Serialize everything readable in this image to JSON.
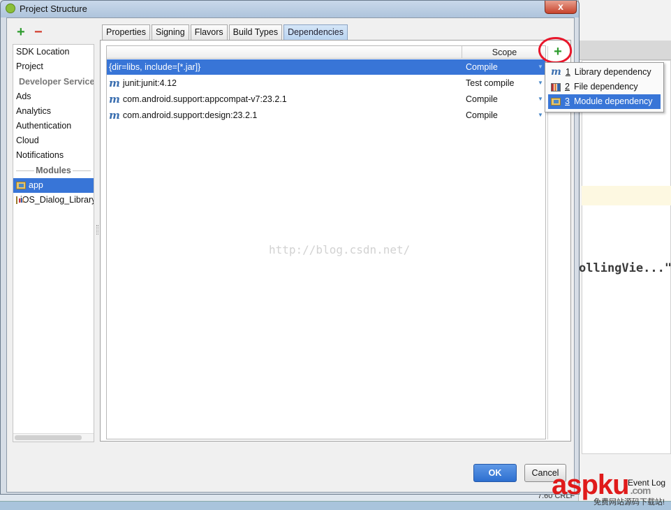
{
  "window": {
    "title": "Project Structure",
    "close_label": "x"
  },
  "background": {
    "code_text": "ollingVie...\"",
    "event_log": "Event Log",
    "status": "7:60  CRLF"
  },
  "watermark": {
    "main": "aspku",
    "suffix": ".com",
    "sub": "免费网站源码下载站!"
  },
  "left_panel": {
    "add_label": "+",
    "remove_label": "−",
    "items": [
      "SDK Location",
      "Project"
    ],
    "developer_services_header": "Developer Services",
    "developer_services": [
      "Ads",
      "Analytics",
      "Authentication",
      "Cloud",
      "Notifications"
    ],
    "modules_header": "Modules",
    "modules": [
      {
        "label": "app",
        "selected": true,
        "icon": "module-folder-icon"
      },
      {
        "label": "iOS_Dialog_Library",
        "selected": false,
        "icon": "library-module-folder-icon"
      }
    ]
  },
  "tabs": [
    "Properties",
    "Signing",
    "Flavors",
    "Build Types",
    "Dependencies"
  ],
  "active_tab": "Dependencies",
  "dependencies": {
    "scope_header": "Scope",
    "add_label": "+",
    "watermark_text": "http://blog.csdn.net/",
    "rows": [
      {
        "name": "{dir=libs, include=[*.jar]}",
        "scope": "Compile",
        "icon": "",
        "selected": true
      },
      {
        "name": "junit:junit:4.12",
        "scope": "Test compile",
        "icon": "m",
        "selected": false
      },
      {
        "name": "com.android.support:appcompat-v7:23.2.1",
        "scope": "Compile",
        "icon": "m",
        "selected": false
      },
      {
        "name": "com.android.support:design:23.2.1",
        "scope": "Compile",
        "icon": "m",
        "selected": false
      }
    ]
  },
  "add_menu": [
    {
      "num": "1",
      "label": "Library dependency",
      "icon": "maven-icon"
    },
    {
      "num": "2",
      "label": "File dependency",
      "icon": "file-jar-icon"
    },
    {
      "num": "3",
      "label": "Module dependency",
      "icon": "module-folder-icon",
      "selected": true
    }
  ],
  "buttons": {
    "ok": "OK",
    "cancel": "Cancel"
  },
  "colors": {
    "selection": "#3875d7",
    "add_green": "#2e9c2e",
    "remove_red": "#d23a2a",
    "annotation_red": "#e8172c"
  }
}
